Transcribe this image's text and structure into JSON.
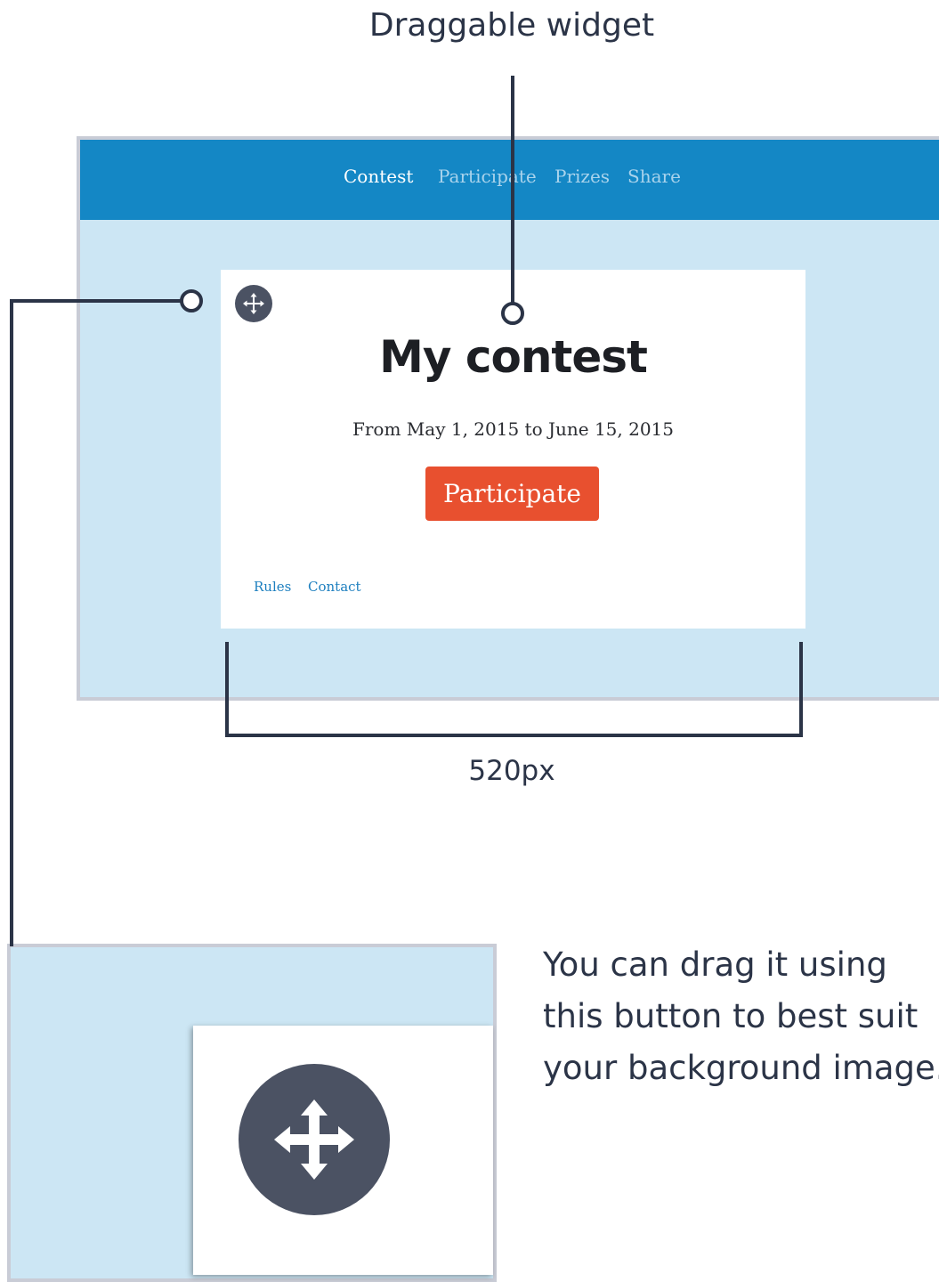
{
  "annotations": {
    "widget_label": "Draggable widget",
    "width_label": "520px",
    "drag_explanation": "You can drag it using this button to best suit your background image."
  },
  "nav": {
    "items": [
      {
        "label": "Contest",
        "active": true
      },
      {
        "label": "Participate",
        "active": false
      },
      {
        "label": "Prizes",
        "active": false
      },
      {
        "label": "Share",
        "active": false
      }
    ]
  },
  "widget": {
    "title": "My contest",
    "dates": "From May 1, 2015 to June 15, 2015",
    "participate_button": "Participate",
    "footer_links": [
      "Rules",
      "Contact"
    ],
    "drag_icon": "move-icon"
  },
  "colors": {
    "nav_background": "#1487c5",
    "page_background": "#cce6f4",
    "participate_button": "#e8502f",
    "drag_handle": "#4b5263",
    "annotation_line": "#2b3447"
  }
}
